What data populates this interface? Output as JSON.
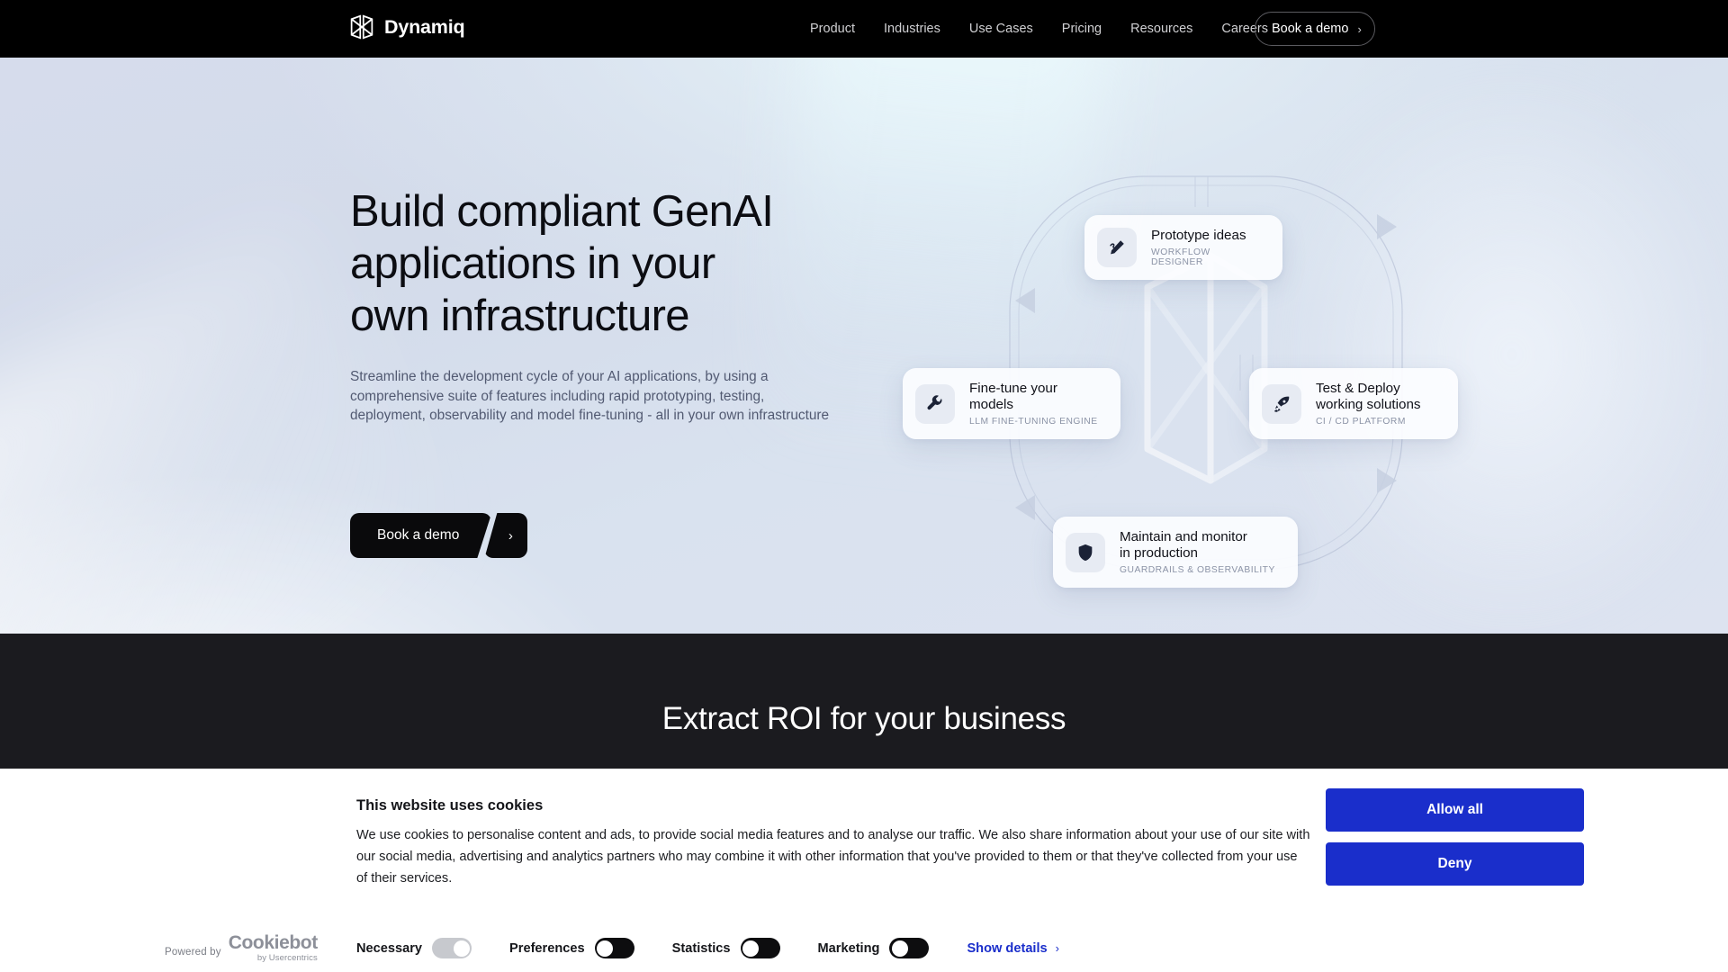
{
  "nav": {
    "brand_name": "Dynamiq",
    "brand_icon": "dynamiq-cube-logo",
    "links": [
      {
        "label": "Product"
      },
      {
        "label": "Industries"
      },
      {
        "label": "Use Cases"
      },
      {
        "label": "Pricing"
      },
      {
        "label": "Resources"
      },
      {
        "label": "Careers"
      }
    ],
    "cta_label": "Book a demo",
    "cta_chevron": "›"
  },
  "hero": {
    "title": "Build compliant GenAI\napplications in your\nown infrastructure",
    "subtitle": "Streamline the development cycle of your AI applications, by using a\ncomprehensive suite of features including rapid prototyping, testing,\ndeployment, observability and model fine-tuning - all in your own infrastructure",
    "cta_label": "Book a demo",
    "cta_arrow": "›",
    "cards": [
      {
        "title": "Prototype ideas",
        "subtitle": "WORKFLOW DESIGNER",
        "icon": "pencil-edit-icon"
      },
      {
        "title": "Fine-tune your\nmodels",
        "subtitle": "LLM FINE-TUNING ENGINE",
        "icon": "wrench-icon"
      },
      {
        "title": "Test & Deploy\nworking solutions",
        "subtitle": "CI / CD PLATFORM",
        "icon": "rocket-icon"
      },
      {
        "title": "Maintain and monitor\nin production",
        "subtitle": "GUARDRAILS & OBSERVABILITY",
        "icon": "shield-icon"
      }
    ]
  },
  "roi_section": {
    "title": "Extract ROI for your business"
  },
  "cookie_banner": {
    "heading": "This website uses cookies",
    "body": "We use cookies to personalise content and ads, to provide social media features and to analyse our traffic. We also share information about your use of our site with our social media, advertising and analytics partners who may combine it with other information that you've provided to them or that they've collected from your use of their services.",
    "allow_all_label": "Allow all",
    "deny_label": "Deny",
    "powered_by": "Powered by",
    "brand_name": "Cookiebot",
    "brand_by": "by Usercentrics",
    "show_details_label": "Show details",
    "show_details_chevron": "›",
    "toggles": [
      {
        "label": "Necessary",
        "state": "on-locked"
      },
      {
        "label": "Preferences",
        "state": "off"
      },
      {
        "label": "Statistics",
        "state": "off"
      },
      {
        "label": "Marketing",
        "state": "off"
      }
    ]
  },
  "colors": {
    "nav_background": "#000000",
    "hero_gradient_start": "#d6dcec",
    "hero_gradient_end": "#dde3f0",
    "roi_background": "#1b1b1f",
    "cookie_accent": "#1a2ecb",
    "cta_dark": "#0a0a0c"
  }
}
